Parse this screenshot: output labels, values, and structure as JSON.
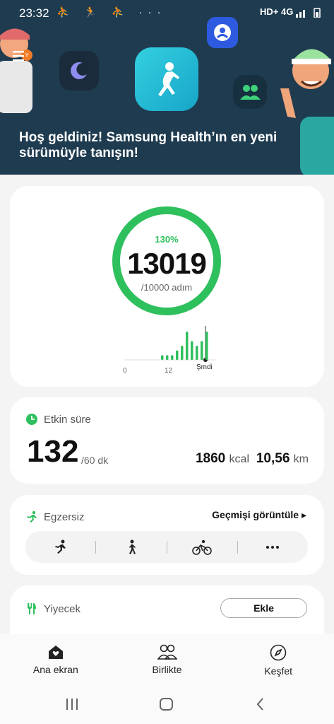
{
  "statusbar": {
    "time": "23:32",
    "notification_icons": "⛹ 🏃 ⛹ ···",
    "right": "HD+ 4G"
  },
  "banner": {
    "title": "Hoş geldiniz! Samsung Health’ın en yeni sürümüyle tanışın!"
  },
  "steps": {
    "percent": "130%",
    "count": "13019",
    "goal": "/10000 adım",
    "progress_fraction": 1.0,
    "chart_labels": [
      "0",
      "12",
      "Şmdi"
    ],
    "hourly": [
      1,
      1,
      1,
      2,
      3,
      6,
      4,
      3,
      4,
      6
    ]
  },
  "active": {
    "label": "Etkin süre",
    "minutes": "132",
    "goal": "/60 dk",
    "kcal_value": "1860",
    "kcal_unit": "kcal",
    "km_value": "10,56",
    "km_unit": "km"
  },
  "exercise": {
    "label": "Egzersiz",
    "history": "Geçmişi görüntüle ▸"
  },
  "food": {
    "label": "Yiyecek",
    "add": "Ekle"
  },
  "nav": {
    "home": "Ana ekran",
    "together": "Birlikte",
    "discover": "Keşfet"
  },
  "colors": {
    "green": "#2fc05e",
    "banner": "#1f3b50"
  }
}
